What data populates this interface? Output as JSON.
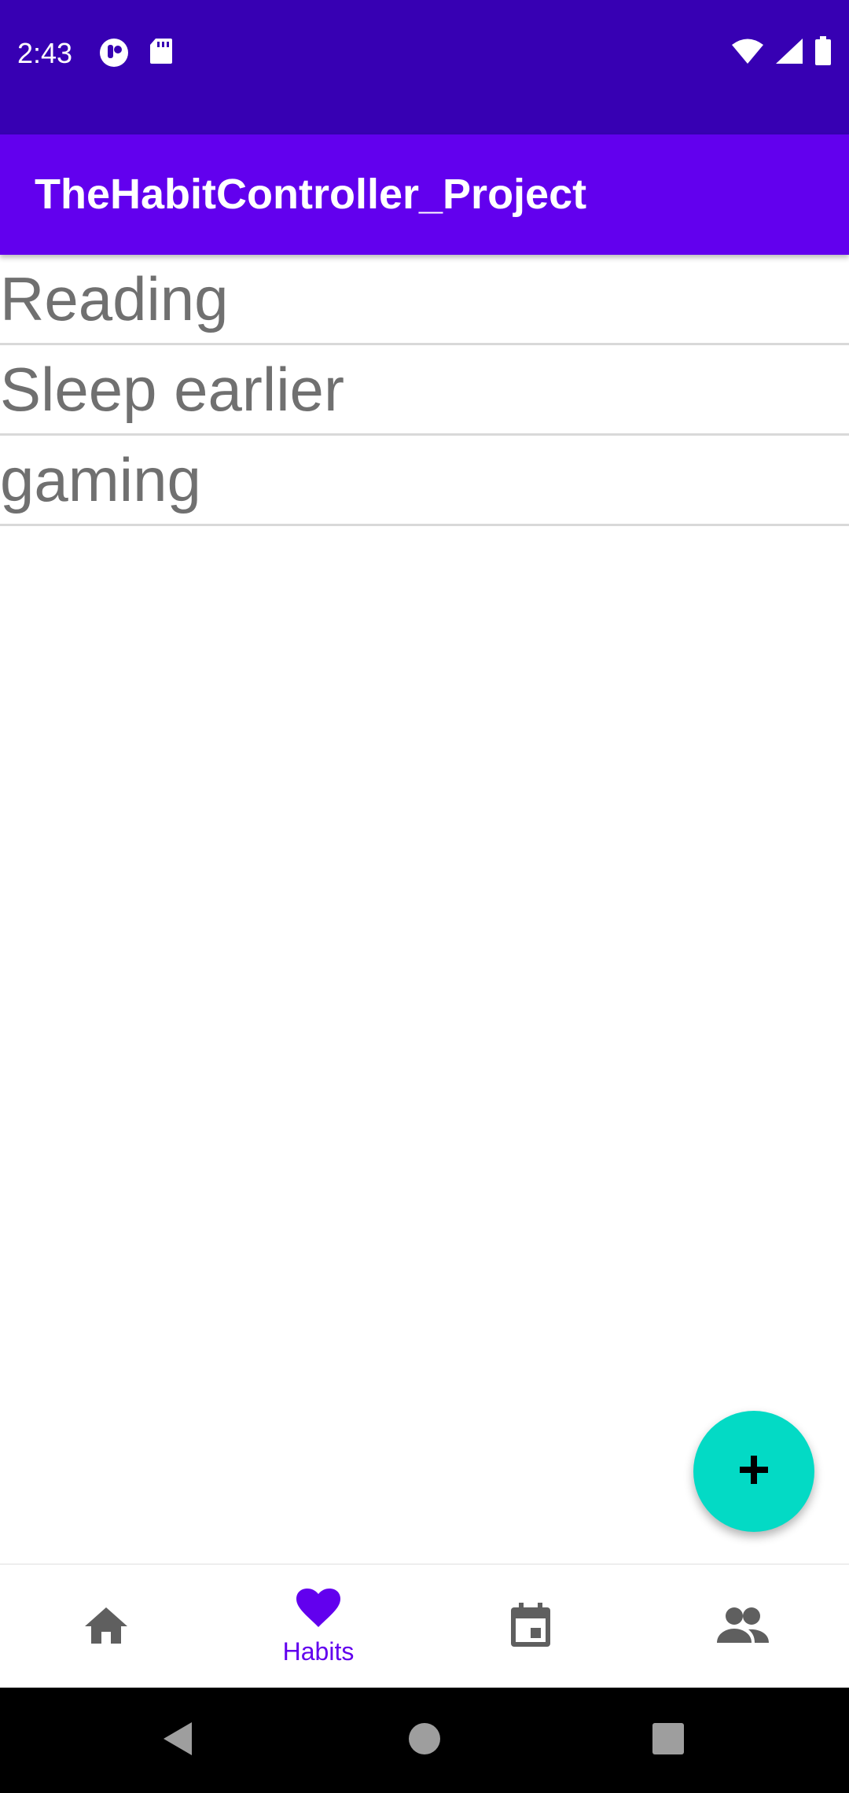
{
  "status_bar": {
    "time": "2:43",
    "icons_left": [
      "t-app-icon",
      "sd-card-icon"
    ],
    "icons_right": [
      "wifi-icon",
      "signal-icon",
      "battery-icon"
    ]
  },
  "app_bar": {
    "title": "TheHabitController_Project"
  },
  "habits": [
    {
      "name": "Reading"
    },
    {
      "name": "Sleep earlier"
    },
    {
      "name": "gaming"
    }
  ],
  "fab": {
    "icon": "plus-icon"
  },
  "bottom_nav": {
    "items": [
      {
        "icon": "home-icon",
        "label": "",
        "selected": false
      },
      {
        "icon": "heart-icon",
        "label": "Habits",
        "selected": true
      },
      {
        "icon": "calendar-icon",
        "label": "",
        "selected": false
      },
      {
        "icon": "people-icon",
        "label": "",
        "selected": false
      }
    ]
  },
  "colors": {
    "status_bar": "#3700B3",
    "app_bar": "#6200EE",
    "fab": "#03DAC5",
    "accent": "#6200EE",
    "inactive_icon": "#5f5f5f",
    "list_text": "#707070"
  }
}
